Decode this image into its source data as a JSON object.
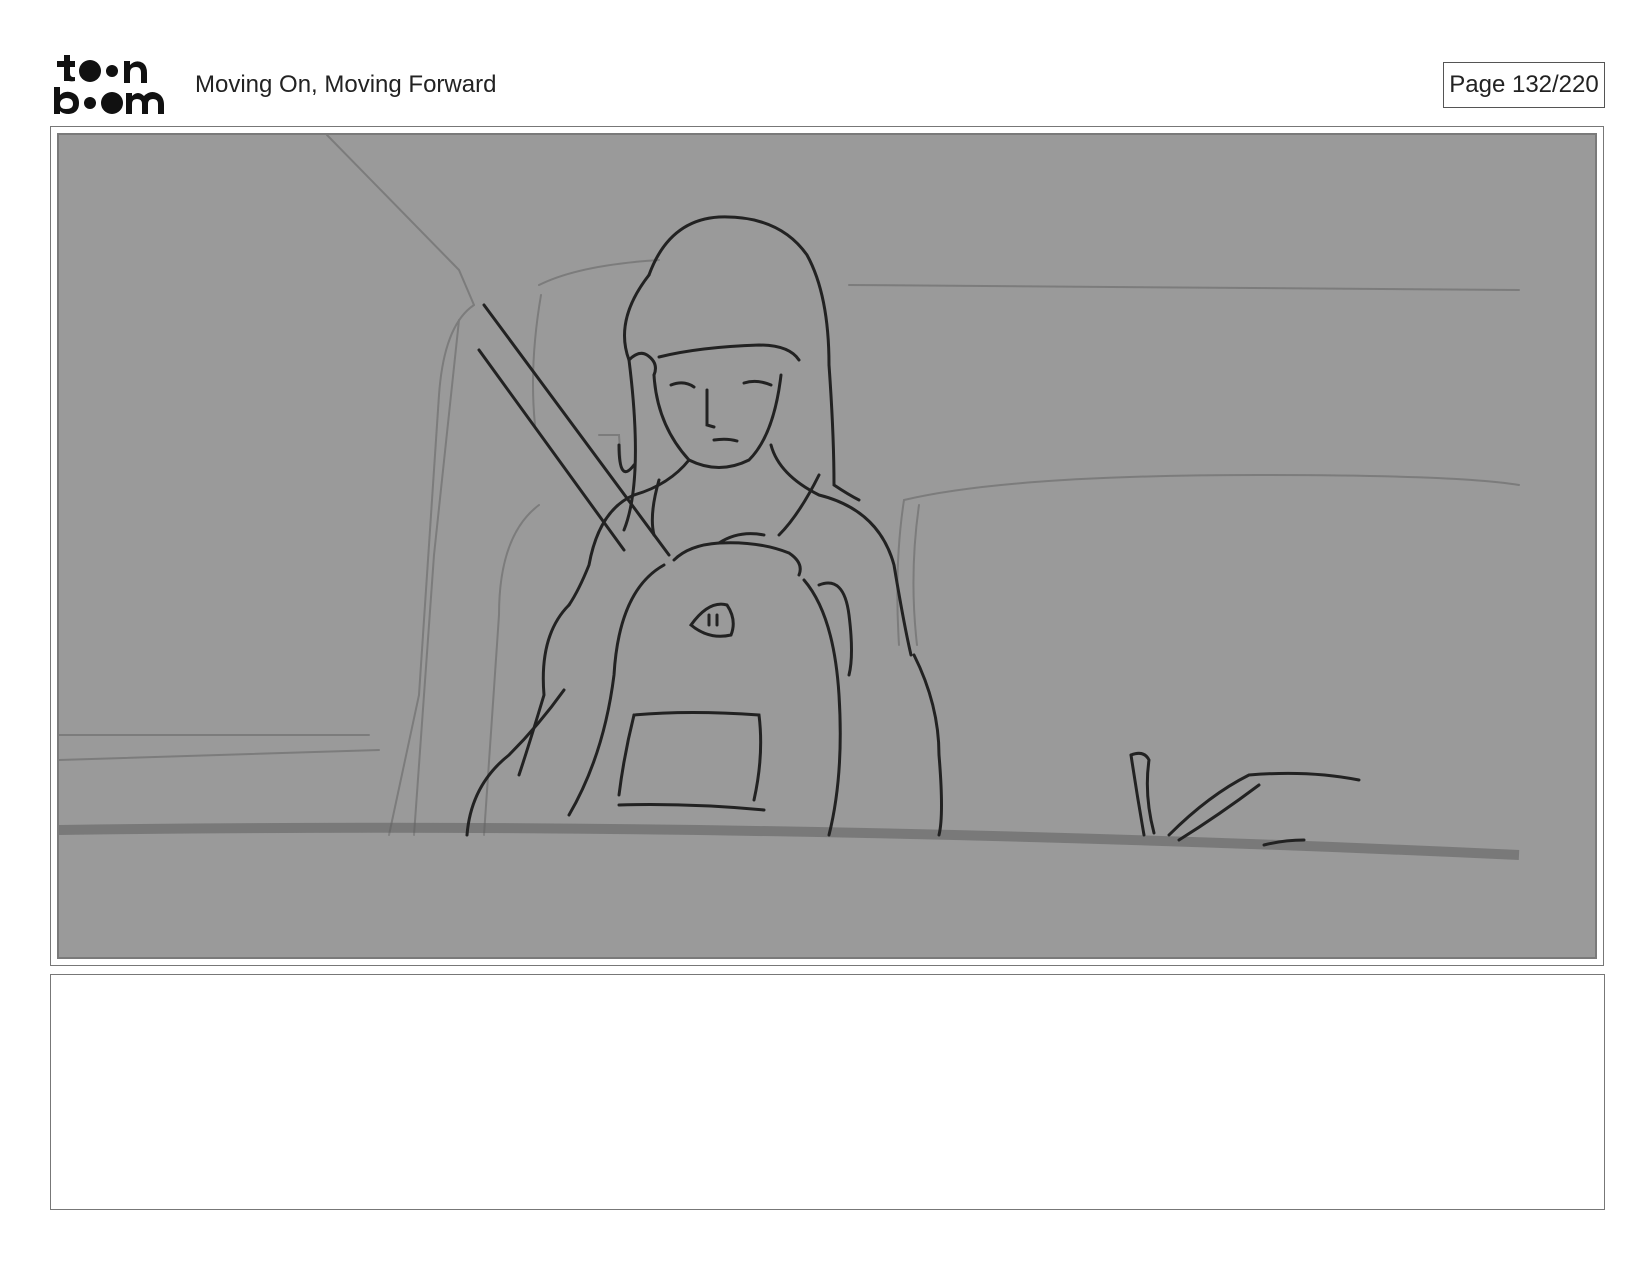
{
  "header": {
    "logo_text": "toon boom",
    "title": "Moving On, Moving Forward",
    "page_label": "Page 132/220"
  },
  "panel": {
    "sketch_subject": "girl-with-backpack-in-car-seat"
  },
  "notes": {
    "text": ""
  }
}
